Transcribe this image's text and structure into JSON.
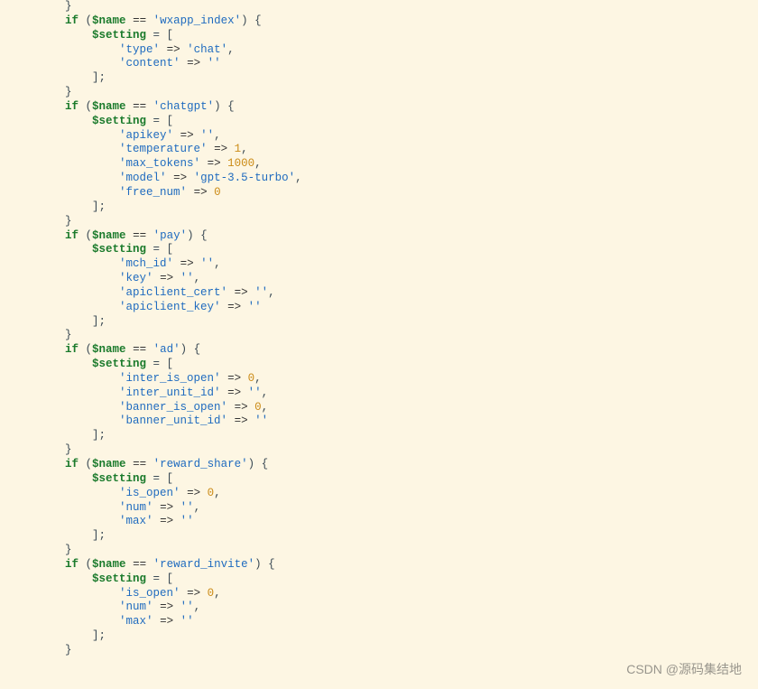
{
  "watermark": "CSDN @源码集结地",
  "kw_if": "if",
  "var_name": "$name",
  "var_setting": "$setting",
  "op_eqeq": "==",
  "op_arrow": "=>",
  "tok_assign_open": " = [",
  "tok_close_arr": "];",
  "tok_open_brace": ") {",
  "tok_close_brace": "}",
  "tok_open_paren": " (",
  "tok_comma": ",",
  "blocks": {
    "wxapp_index": {
      "cond": "'wxapp_index'",
      "items": [
        {
          "key": "'type'",
          "val": "'chat'",
          "comma": ","
        },
        {
          "key": "'content'",
          "val": "''",
          "comma": ""
        }
      ]
    },
    "chatgpt": {
      "cond": "'chatgpt'",
      "items": [
        {
          "key": "'apikey'",
          "val": "''",
          "comma": ","
        },
        {
          "key": "'temperature'",
          "val": "1",
          "num": true,
          "comma": ","
        },
        {
          "key": "'max_tokens'",
          "val": "1000",
          "num": true,
          "comma": ","
        },
        {
          "key": "'model'",
          "val": "'gpt-3.5-turbo'",
          "comma": ","
        },
        {
          "key": "'free_num'",
          "val": "0",
          "num": true,
          "comma": ""
        }
      ]
    },
    "pay": {
      "cond": "'pay'",
      "items": [
        {
          "key": "'mch_id'",
          "val": "''",
          "comma": ","
        },
        {
          "key": "'key'",
          "val": "''",
          "comma": ","
        },
        {
          "key": "'apiclient_cert'",
          "val": "''",
          "comma": ","
        },
        {
          "key": "'apiclient_key'",
          "val": "''",
          "comma": ""
        }
      ]
    },
    "ad": {
      "cond": "'ad'",
      "items": [
        {
          "key": "'inter_is_open'",
          "val": "0",
          "num": true,
          "comma": ","
        },
        {
          "key": "'inter_unit_id'",
          "val": "''",
          "comma": ","
        },
        {
          "key": "'banner_is_open'",
          "val": "0",
          "num": true,
          "comma": ","
        },
        {
          "key": "'banner_unit_id'",
          "val": "''",
          "comma": ""
        }
      ]
    },
    "reward_share": {
      "cond": "'reward_share'",
      "items": [
        {
          "key": "'is_open'",
          "val": "0",
          "num": true,
          "comma": ","
        },
        {
          "key": "'num'",
          "val": "''",
          "comma": ","
        },
        {
          "key": "'max'",
          "val": "''",
          "comma": ""
        }
      ]
    },
    "reward_invite": {
      "cond": "'reward_invite'",
      "items": [
        {
          "key": "'is_open'",
          "val": "0",
          "num": true,
          "comma": ","
        },
        {
          "key": "'num'",
          "val": "''",
          "comma": ","
        },
        {
          "key": "'max'",
          "val": "''",
          "comma": ""
        }
      ]
    }
  }
}
